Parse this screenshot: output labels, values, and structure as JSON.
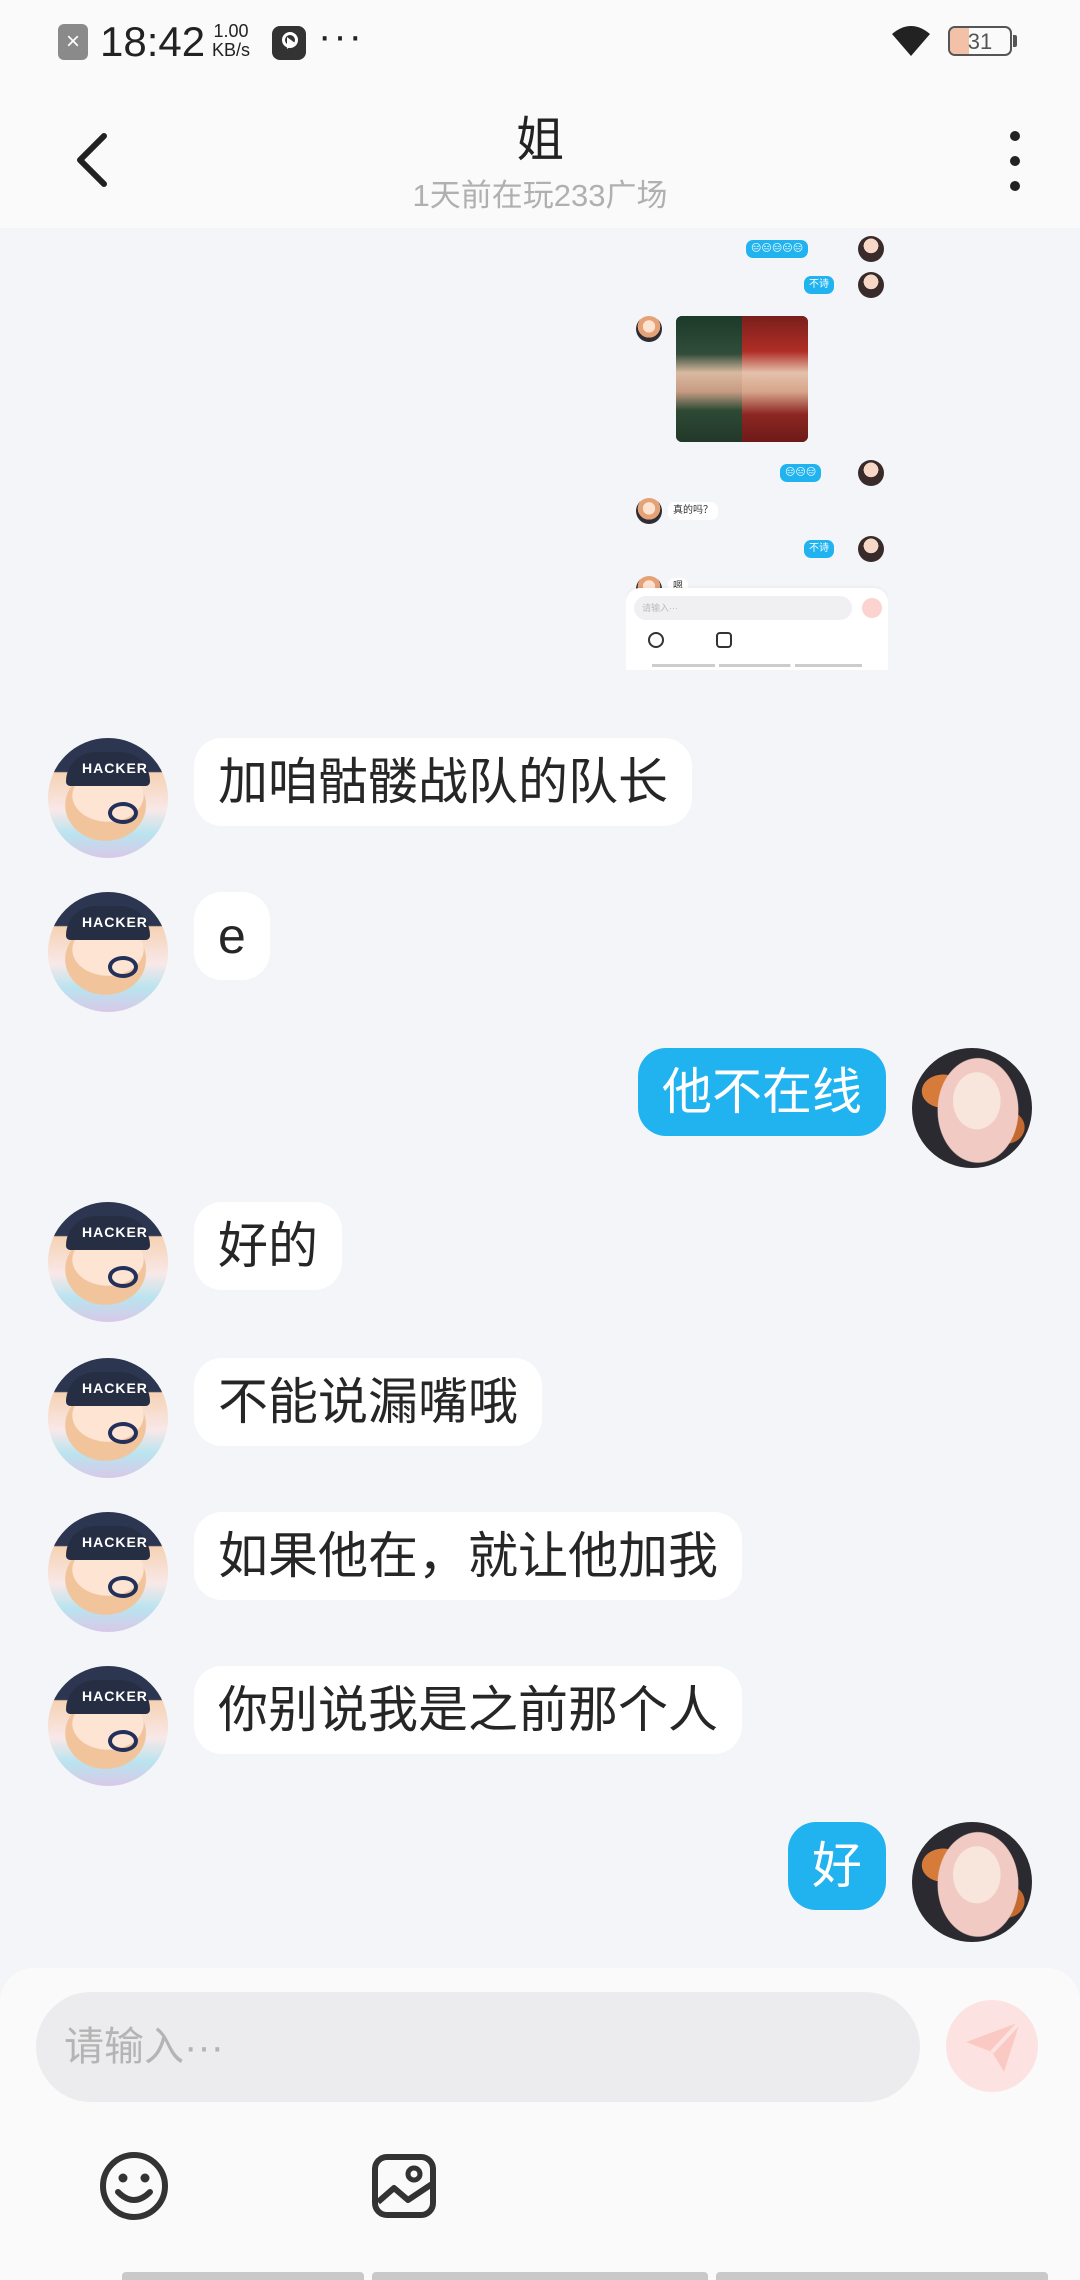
{
  "status_bar": {
    "time": "18:42",
    "net_speed_value": "1.00",
    "net_speed_unit": "KB/s",
    "overflow": "···",
    "battery": "31",
    "battery_level": 0.31
  },
  "header": {
    "title": "姐",
    "subtitle": "1天前在玩233广场"
  },
  "embedded_screenshot": {
    "messages": [
      {
        "side": "right",
        "text": "😑😑😑😑😑"
      },
      {
        "side": "right",
        "text": "不诗"
      },
      {
        "side": "left",
        "text": "真的吗？"
      },
      {
        "side": "right",
        "text": "😑😑😑"
      },
      {
        "side": "right",
        "text": "不诗"
      },
      {
        "side": "left",
        "text": "嗯"
      }
    ],
    "placeholder": "请输入···"
  },
  "messages": [
    {
      "side": "left",
      "text": "加咱骷髅战队的队长"
    },
    {
      "side": "left",
      "text": "e"
    },
    {
      "side": "right",
      "text": "他不在线"
    },
    {
      "side": "left",
      "text": "好的"
    },
    {
      "side": "left",
      "text": "不能说漏嘴哦"
    },
    {
      "side": "left",
      "text": "如果他在，就让他加我"
    },
    {
      "side": "left",
      "text": "你别说我是之前那个人"
    },
    {
      "side": "right",
      "text": "好"
    }
  ],
  "friend_avatar_cap_text": "HACKER",
  "input": {
    "placeholder": "请输入···"
  },
  "colors": {
    "accent": "#21b3f0",
    "background": "#f4f5f8",
    "send_disabled": "#fce3e1"
  },
  "icons": [
    "back-icon",
    "more-icon",
    "emoji-icon",
    "image-icon",
    "send-icon"
  ]
}
